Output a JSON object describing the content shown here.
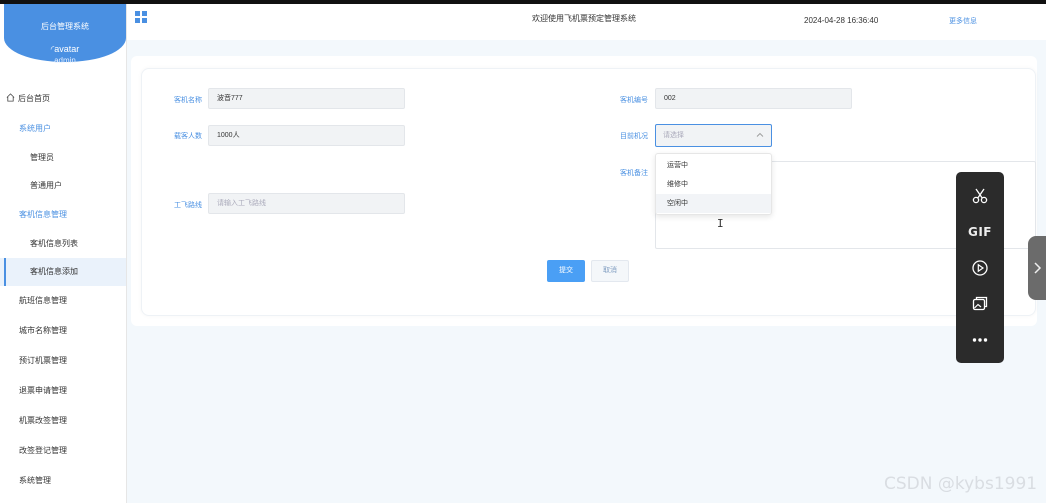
{
  "app": {
    "brand_title": "后台管理系统",
    "avatar_alt": "avatar",
    "username": "admin"
  },
  "header": {
    "title": "欢迎使用飞机票预定管理系统",
    "datetime": "2024-04-28 16:36:40",
    "more_link": "更多信息"
  },
  "sidebar": {
    "items": [
      {
        "label": "后台首页",
        "type": "home"
      },
      {
        "label": "系统用户",
        "type": "group"
      },
      {
        "label": "管理员",
        "type": "sub"
      },
      {
        "label": "普通用户",
        "type": "sub"
      },
      {
        "label": "客机信息管理",
        "type": "group"
      },
      {
        "label": "客机信息列表",
        "type": "sub"
      },
      {
        "label": "客机信息添加",
        "type": "sub-active"
      },
      {
        "label": "航班信息管理",
        "type": "top"
      },
      {
        "label": "城市名称管理",
        "type": "top"
      },
      {
        "label": "预订机票管理",
        "type": "top"
      },
      {
        "label": "退票申请管理",
        "type": "top"
      },
      {
        "label": "机票改签管理",
        "type": "top"
      },
      {
        "label": "改签登记管理",
        "type": "top"
      },
      {
        "label": "系统管理",
        "type": "top"
      }
    ]
  },
  "form": {
    "name_label": "客机名称",
    "name_value": "波音777",
    "number_label": "客机编号",
    "number_value": "002",
    "capacity_label": "载客人数",
    "capacity_value": "1000人",
    "status_label": "目前机况",
    "status_placeholder": "请选择",
    "status_options": [
      "运营中",
      "维修中",
      "空闲中"
    ],
    "remark_label": "客机备注",
    "route_label": "工飞路线",
    "route_placeholder": "请输入工飞路线",
    "submit_label": "提交",
    "cancel_label": "取消"
  },
  "toolbar": {
    "items": [
      "scissors-icon",
      "gif-icon",
      "record-icon",
      "image-icon",
      "more-icon"
    ],
    "gif_label": "GIF"
  },
  "watermark": "CSDN @kybs1991",
  "colors": {
    "accent": "#4a90e2",
    "submit": "#4a9ff5",
    "toolbar_bg": "#2b2b2b"
  }
}
